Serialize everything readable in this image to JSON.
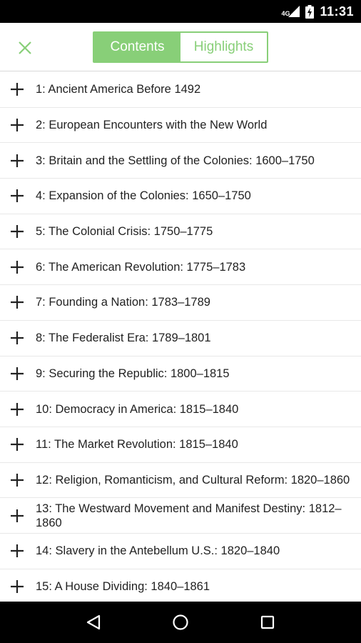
{
  "status_bar": {
    "network": "4G",
    "time": "11:31",
    "icons": [
      "signal-icon",
      "battery-charging-icon"
    ]
  },
  "header": {
    "close_icon": "close-icon",
    "tabs": [
      {
        "label": "Contents",
        "active": true
      },
      {
        "label": "Highlights",
        "active": false
      }
    ]
  },
  "colors": {
    "accent": "#88cf78",
    "text": "#222222",
    "divider": "#e8e8e8",
    "system_bars": "#000000"
  },
  "contents": {
    "expand_icon": "plus-icon",
    "items": [
      {
        "label": "1: Ancient America Before 1492"
      },
      {
        "label": "2: European Encounters with the New World"
      },
      {
        "label": "3: Britain and the Settling of the Colonies: 1600–1750"
      },
      {
        "label": "4: Expansion of the Colonies: 1650–1750"
      },
      {
        "label": "5: The Colonial Crisis: 1750–1775"
      },
      {
        "label": "6: The American Revolution: 1775–1783"
      },
      {
        "label": "7: Founding a Nation: 1783–1789"
      },
      {
        "label": "8: The Federalist Era: 1789–1801"
      },
      {
        "label": "9: Securing the Republic: 1800–1815"
      },
      {
        "label": "10: Democracy in America: 1815–1840"
      },
      {
        "label": "11: The Market Revolution: 1815–1840"
      },
      {
        "label": "12: Religion, Romanticism, and Cultural Reform: 1820–1860"
      },
      {
        "label": "13: The Westward Movement and Manifest Destiny: 1812–1860"
      },
      {
        "label": "14: Slavery in the Antebellum U.S.: 1820–1840"
      },
      {
        "label": "15: A House Dividing: 1840–1861"
      }
    ]
  },
  "nav_bar": {
    "icons": [
      "back-icon",
      "home-icon",
      "recents-icon"
    ]
  }
}
